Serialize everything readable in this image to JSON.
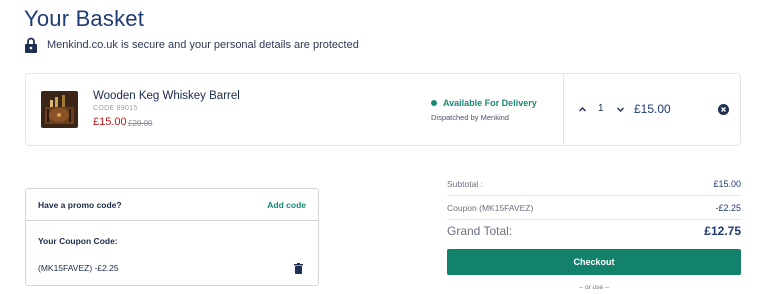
{
  "page": {
    "title": "Your Basket",
    "secure_message": "Menkind.co.uk is secure and your personal details are protected"
  },
  "item": {
    "name": "Wooden Keg Whiskey Barrel",
    "code": "CODE 89015",
    "price": "£15.00",
    "was_price": "£20.00",
    "delivery_status": "Available For Delivery",
    "dispatch": "Dispatched by Menkind",
    "quantity": "1",
    "line_total": "£15.00"
  },
  "promo": {
    "question": "Have a promo code?",
    "add_label": "Add code",
    "coupon_label": "Your Coupon Code:",
    "coupon_applied": "(MK15FAVEZ) -£2.25"
  },
  "summary": {
    "subtotal_label": "Subtotal :",
    "subtotal_value": "£15.00",
    "coupon_label": "Coupon (MK15FAVEZ)",
    "coupon_value": "-£2.25",
    "grand_label": "Grand Total:",
    "grand_value": "£12.75",
    "checkout_label": "Checkout",
    "or_use": "-- or use --"
  },
  "icons": {
    "lock": "lock-icon",
    "delivery_dot": "status-dot-icon",
    "qty_up": "chevron-up-icon",
    "qty_down": "chevron-down-icon",
    "remove": "close-circle-icon",
    "trash": "trash-icon"
  },
  "colors": {
    "brand_navy": "#1f3b73",
    "accent_green": "#12826b",
    "sale_red": "#c3161c"
  }
}
